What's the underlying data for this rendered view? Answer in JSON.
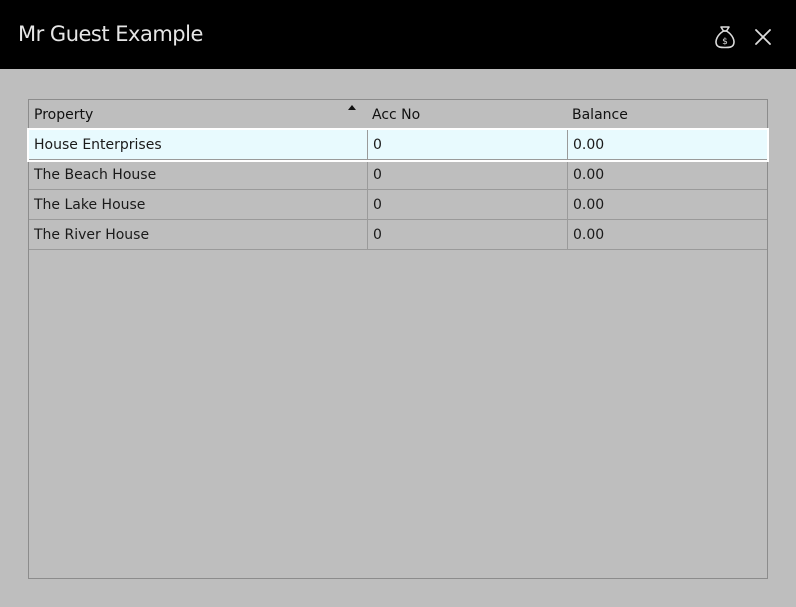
{
  "window": {
    "title": "Mr Guest Example"
  },
  "header_icons": {
    "money": "money-bag-dollar-icon",
    "close": "close-icon"
  },
  "table": {
    "columns": [
      "Property",
      "Acc No",
      "Balance"
    ],
    "sort": {
      "column": "Property",
      "direction": "ascending"
    },
    "rows": [
      {
        "property": "House Enterprises",
        "acc_no": "0",
        "balance": "0.00",
        "selected": true
      },
      {
        "property": "The Beach House",
        "acc_no": "0",
        "balance": "0.00",
        "selected": false
      },
      {
        "property": "The Lake House",
        "acc_no": "0",
        "balance": "0.00",
        "selected": false
      },
      {
        "property": "The River House",
        "acc_no": "0",
        "balance": "0.00",
        "selected": false
      }
    ]
  },
  "colors": {
    "header_bg": "#000000",
    "body_bg": "#bebebe",
    "selected_row": "#e8fafe"
  }
}
